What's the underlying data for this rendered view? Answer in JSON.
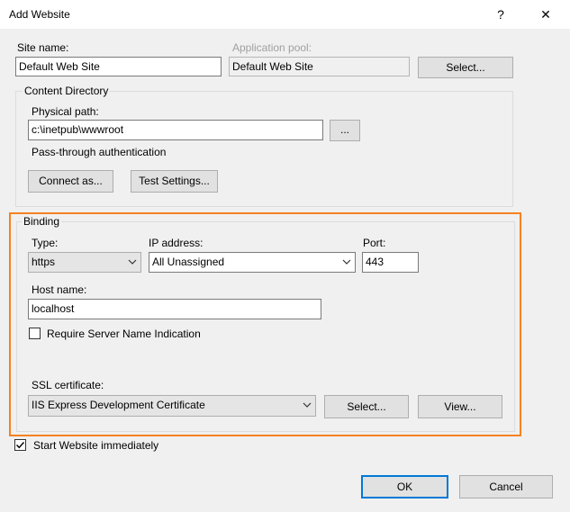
{
  "dialog": {
    "title": "Add Website",
    "help_glyph": "?",
    "close_glyph": "✕"
  },
  "site": {
    "site_name_label": "Site name:",
    "site_name_value": "Default Web Site",
    "app_pool_label": "Application pool:",
    "app_pool_value": "Default Web Site",
    "select_pool_button": "Select..."
  },
  "content": {
    "group_title": "Content Directory",
    "physical_path_label": "Physical path:",
    "physical_path_value": "c:\\inetpub\\wwwroot",
    "browse_button": "...",
    "pass_through_label": "Pass-through authentication",
    "connect_as_button": "Connect as...",
    "test_settings_button": "Test Settings..."
  },
  "binding": {
    "group_title": "Binding",
    "type_label": "Type:",
    "type_value": "https",
    "ip_label": "IP address:",
    "ip_value": "All Unassigned",
    "port_label": "Port:",
    "port_value": "443",
    "host_label": "Host name:",
    "host_value": "localhost",
    "sni_label": "Require Server Name Indication",
    "sni_checked": false,
    "ssl_label": "SSL certificate:",
    "ssl_value": "IIS Express Development Certificate",
    "ssl_select_button": "Select...",
    "ssl_view_button": "View..."
  },
  "footer": {
    "start_label": "Start Website immediately",
    "start_checked": true,
    "ok_button": "OK",
    "cancel_button": "Cancel"
  },
  "colors": {
    "highlight": "#f58220",
    "default_button_border": "#0078d7"
  }
}
